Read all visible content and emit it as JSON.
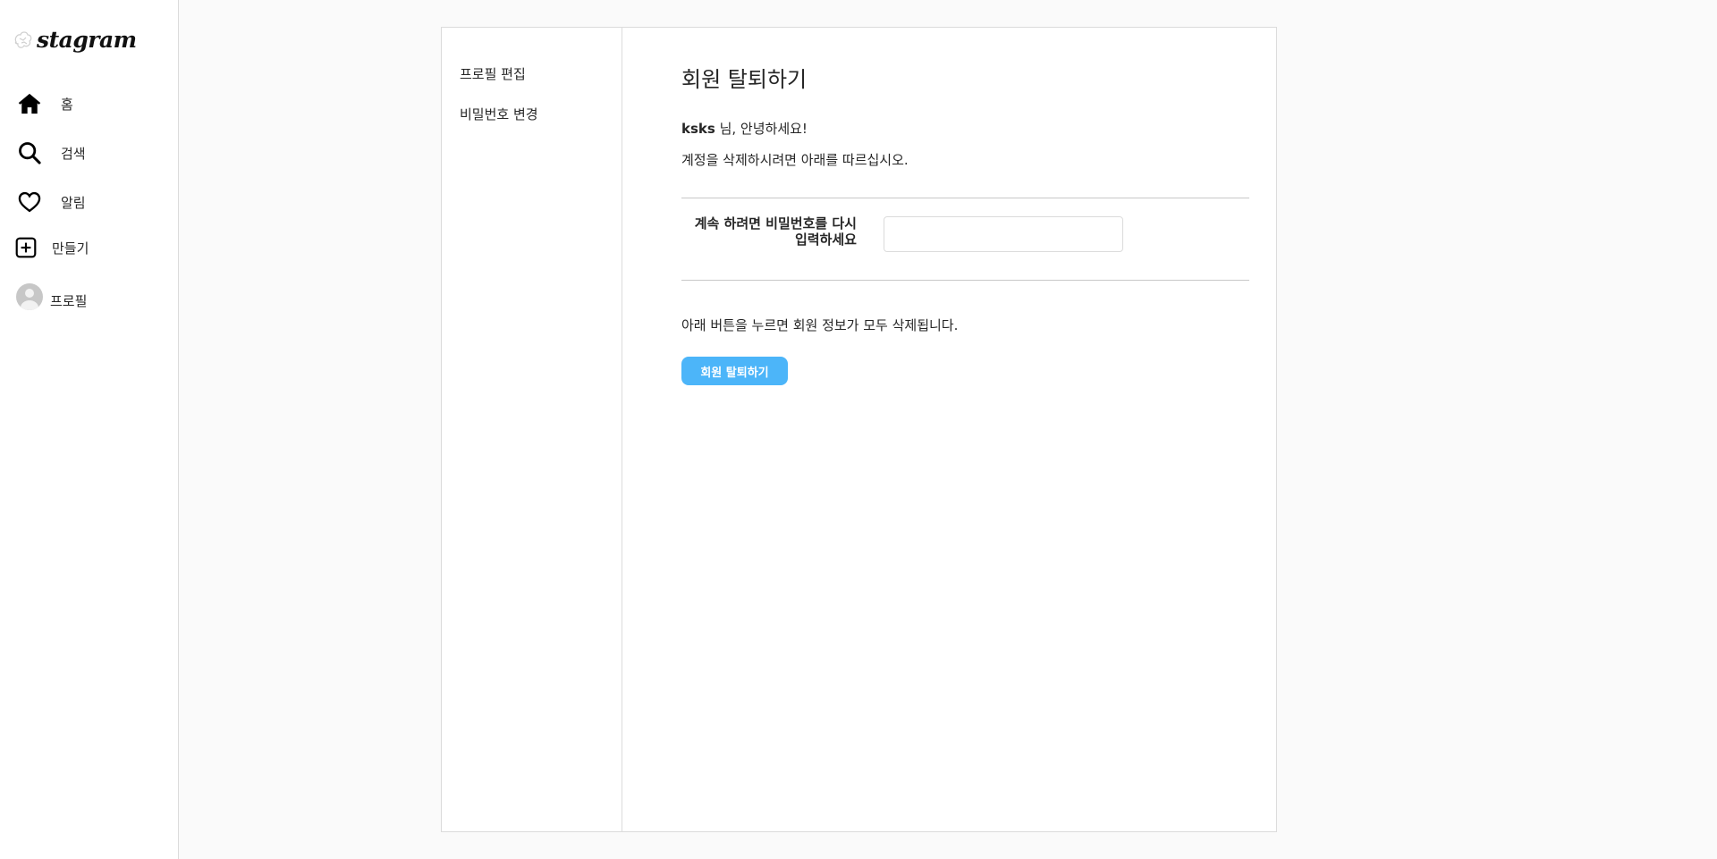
{
  "sidebar": {
    "logo_text": "stagram",
    "items": [
      {
        "label": "홈",
        "icon": "home-icon"
      },
      {
        "label": "검색",
        "icon": "search-icon"
      },
      {
        "label": "알림",
        "icon": "heart-icon"
      },
      {
        "label": "만들기",
        "icon": "plus-square-icon"
      },
      {
        "label": "프로필",
        "icon": "avatar"
      }
    ]
  },
  "settings_nav": {
    "items": [
      {
        "label": "프로필 편집"
      },
      {
        "label": "비밀번호 변경"
      }
    ]
  },
  "main": {
    "title": "회원 탈퇴하기",
    "username": "ksks",
    "greeting_suffix": " 님, 안녕하세요!",
    "instruction": "계정을 삭제하시려면 아래를 따르십시오.",
    "password_label": "계속 하려면 비밀번호를 다시 입력하세요",
    "password_value": "",
    "warning": "아래 버튼을 누르면 회원 정보가 모두 삭제됩니다.",
    "delete_button_label": "회원 탈퇴하기"
  },
  "colors": {
    "accent": "#4cb5f9",
    "border": "#dbdbdb",
    "background": "#fafafa"
  }
}
